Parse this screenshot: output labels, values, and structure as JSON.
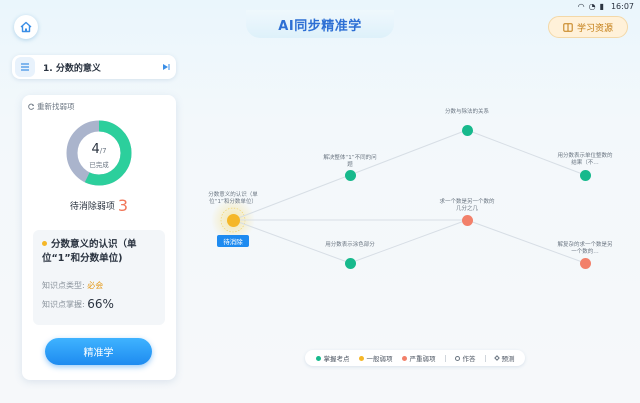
{
  "status": {
    "time": "16:07"
  },
  "header": {
    "title": "AI同步精准学",
    "study_resource": "学习资源"
  },
  "chapter": {
    "label": "1. 分数的意义"
  },
  "left_panel": {
    "refind": "重新找弱项",
    "done": "4",
    "total": "/7",
    "done_label": "已完成",
    "done_fraction": 0.571,
    "pending_label": "待消除弱项",
    "pending_count": "3",
    "kp_title": "分数意义的认识（单位“1”和分数单位)",
    "type_label": "知识点类型:",
    "type_value": "必会",
    "mastery_label": "知识点掌握:",
    "mastery_value": "66%",
    "button": "精准学"
  },
  "map": {
    "nodes": [
      {
        "label": "分数与除法的关系",
        "status": "green"
      },
      {
        "label": "解决整体“1”不同的问题",
        "status": "green"
      },
      {
        "label": "用分数表示单位整数的结果（不…",
        "status": "green"
      },
      {
        "label": "分数意义的认识（单位“1”和分数单位）",
        "status": "yellow"
      },
      {
        "label": "求一个数是另一个数的几分之几",
        "status": "red"
      },
      {
        "label": "用分数表示涂色部分",
        "status": "green"
      },
      {
        "label": "解复杂的求一个数是另一个数的…",
        "status": "red"
      }
    ],
    "pending_tag": "待消除"
  },
  "legend": {
    "items": [
      {
        "label": "掌握考点",
        "color": "#17b98c"
      },
      {
        "label": "一般弱项",
        "color": "#f5b728"
      },
      {
        "label": "严重弱项",
        "color": "#f2806a"
      },
      {
        "label": "作答",
        "shape": "circle-outline"
      },
      {
        "label": "预测",
        "shape": "diamond-outline"
      }
    ]
  },
  "colors": {
    "accent": "#1e8bf0",
    "green": "#17b98c",
    "yellow": "#f5b728",
    "red": "#f2806a"
  }
}
